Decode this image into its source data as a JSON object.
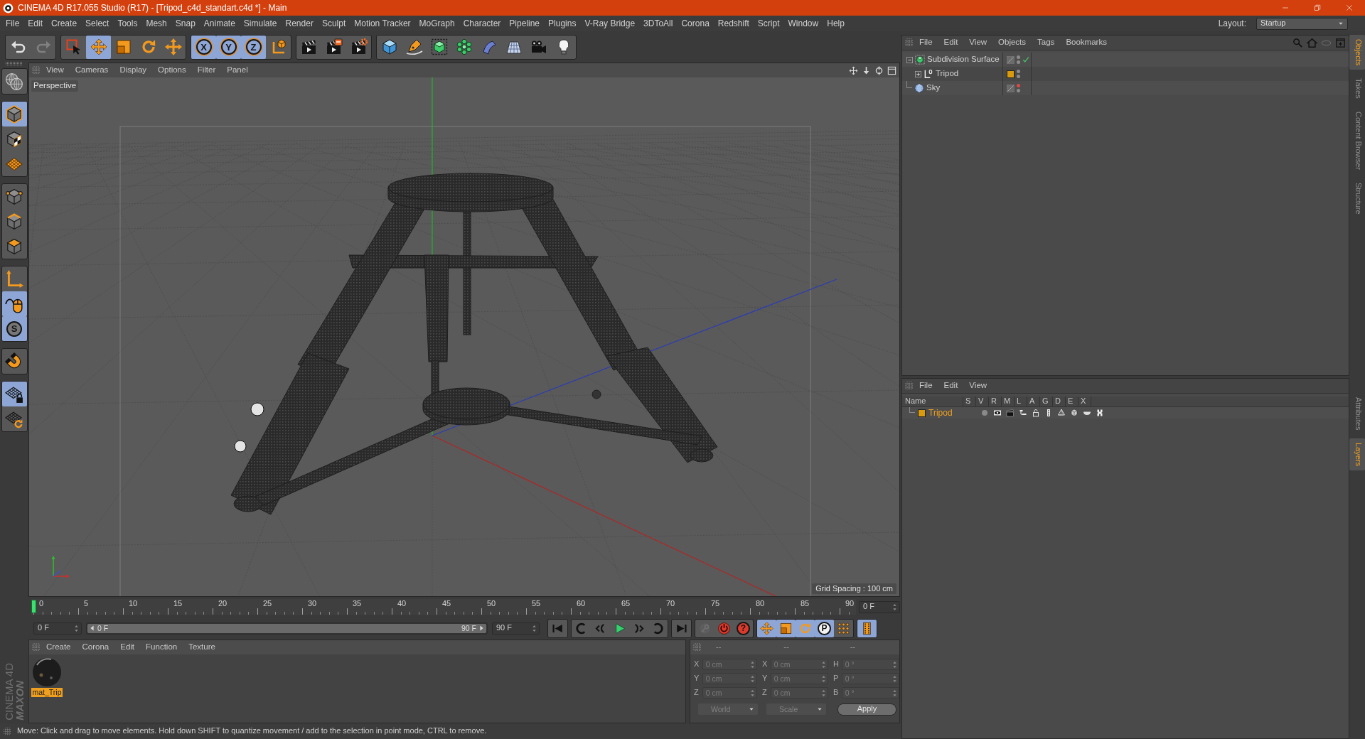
{
  "window": {
    "title": "CINEMA 4D R17.055 Studio (R17) - [Tripod_c4d_standart.c4d *] - Main"
  },
  "menu_bar": {
    "items": [
      "File",
      "Edit",
      "Create",
      "Select",
      "Tools",
      "Mesh",
      "Snap",
      "Animate",
      "Simulate",
      "Render",
      "Sculpt",
      "Motion Tracker",
      "MoGraph",
      "Character",
      "Pipeline",
      "Plugins",
      "V-Ray Bridge",
      "3DToAll",
      "Corona",
      "Redshift",
      "Script",
      "Window",
      "Help"
    ],
    "layout_label": "Layout:",
    "layout_value": "Startup"
  },
  "toolbar": {
    "groups": [
      [
        {
          "disabled": false
        },
        {
          "disabled": true
        }
      ],
      [
        {
          "selected": false
        },
        {
          "selected": true
        },
        {
          "selected": false
        },
        {
          "selected": false
        },
        {
          "selected": false
        }
      ],
      [
        {
          "label": "X",
          "selected": true
        },
        {
          "label": "Y",
          "selected": true
        },
        {
          "label": "Z",
          "selected": true
        },
        {
          "selected": false
        }
      ],
      [
        {
          "selected": false
        },
        {
          "selected": false
        },
        {
          "selected": false
        }
      ],
      [
        {
          "selected": false
        },
        {
          "selected": false
        },
        {
          "selected": false
        },
        {
          "selected": false
        },
        {
          "selected": false
        },
        {
          "selected": false
        },
        {
          "selected": false
        },
        {
          "selected": false
        }
      ]
    ]
  },
  "mode_palette": {
    "groups": [
      [
        {
          "selected": false
        }
      ],
      [
        {
          "selected": true
        },
        {
          "selected": false
        },
        {
          "selected": false
        }
      ],
      [
        {
          "selected": false
        },
        {
          "selected": false
        },
        {
          "selected": false
        }
      ],
      [
        {
          "selected": false
        },
        {
          "selected": true
        },
        {
          "label": "S",
          "selected": true
        }
      ],
      [
        {
          "selected": false
        }
      ],
      [
        {
          "selected": true
        },
        {
          "selected": false
        }
      ]
    ]
  },
  "viewport": {
    "menu": [
      "View",
      "Cameras",
      "Display",
      "Options",
      "Filter",
      "Panel"
    ],
    "camera": "Perspective",
    "grid_spacing": "Grid Spacing : 100 cm"
  },
  "timeline": {
    "ticks": [
      "0",
      "5",
      "10",
      "15",
      "20",
      "25",
      "30",
      "35",
      "40",
      "45",
      "50",
      "55",
      "60",
      "65",
      "70",
      "75",
      "80",
      "85",
      "90"
    ],
    "level": 0,
    "current_frame": "0 F"
  },
  "playback": {
    "start_frame": "0 F",
    "range": {
      "start": "0 F",
      "end": "90 F",
      "level": 1
    },
    "end_frame": "90 F",
    "groups": [
      [
        {
          "selected": false
        }
      ],
      [
        {
          "selected": false
        },
        {
          "selected": false
        },
        {
          "selected": false
        },
        {
          "selected": false
        },
        {
          "selected": false
        }
      ],
      [
        {
          "selected": false
        }
      ],
      [
        {
          "selected": false,
          "disabled": true
        },
        {
          "selected": false,
          "disabled": false
        },
        {
          "label": "?",
          "selected": false,
          "disabled": false
        }
      ],
      [
        {
          "selected": true
        },
        {
          "selected": true
        },
        {
          "selected": true
        },
        {
          "label": "P",
          "selected": true
        },
        {
          "selected": false
        }
      ],
      [
        {
          "selected": true
        }
      ]
    ]
  },
  "material_manager": {
    "menu": [
      "Create",
      "Corona",
      "Edit",
      "Function",
      "Texture"
    ],
    "materials": [
      {
        "name": "mat_Trip",
        "selected": true
      }
    ]
  },
  "coordinates": {
    "disabled": true,
    "headers": [
      "--",
      "--",
      "--"
    ],
    "rows": [
      [
        {
          "label": "X",
          "value": "0 cm"
        },
        {
          "label": "X",
          "value": "0 cm"
        },
        {
          "label": "H",
          "value": "0 °"
        }
      ],
      [
        {
          "label": "Y",
          "value": "0 cm"
        },
        {
          "label": "Y",
          "value": "0 cm"
        },
        {
          "label": "P",
          "value": "0 °"
        }
      ],
      [
        {
          "label": "Z",
          "value": "0 cm"
        },
        {
          "label": "Z",
          "value": "0 cm"
        },
        {
          "label": "B",
          "value": "0 °"
        }
      ]
    ],
    "dropdowns": [
      "World",
      "Scale"
    ],
    "apply": "Apply"
  },
  "branding": {
    "line_1": "MAXON",
    "line_2": "CINEMA 4D"
  },
  "status_bar": {
    "text": "Move: Click and drag to move elements. Hold down SHIFT to quantize movement / add to the selection in point mode, CTRL to remove."
  },
  "object_manager": {
    "menu": [
      "File",
      "Edit",
      "View",
      "Objects",
      "Tags",
      "Bookmarks"
    ],
    "objects": [
      {
        "name": "Subdivision Surface",
        "kind": "subdivision",
        "expanded": true,
        "editor_hidden": false,
        "render_hidden": false,
        "enabled": true,
        "children": [
          {
            "name": "Tripod",
            "kind": "null",
            "expanded": false,
            "color": "#d99a0e",
            "editor_hidden": false,
            "render_hidden": false
          }
        ]
      },
      {
        "name": "Sky",
        "kind": "sky",
        "editor_hidden": true,
        "render_hidden": false
      }
    ]
  },
  "layer_manager": {
    "menu": [
      "File",
      "Edit",
      "View"
    ],
    "columns": [
      "Name",
      "S",
      "V",
      "R",
      "M",
      "L",
      "A",
      "G",
      "D",
      "E",
      "X"
    ],
    "layers": [
      {
        "name": "Tripod",
        "color": "#d99a0e"
      }
    ]
  },
  "side_tabs": {
    "upper": [
      {
        "label": "Objects",
        "selected": true
      },
      {
        "label": "Takes",
        "selected": false
      },
      {
        "label": "Content Browser",
        "selected": false
      },
      {
        "label": "Structure",
        "selected": false
      }
    ],
    "lower": [
      {
        "label": "Attributes",
        "selected": false
      },
      {
        "label": "Layers",
        "selected": true
      }
    ]
  }
}
